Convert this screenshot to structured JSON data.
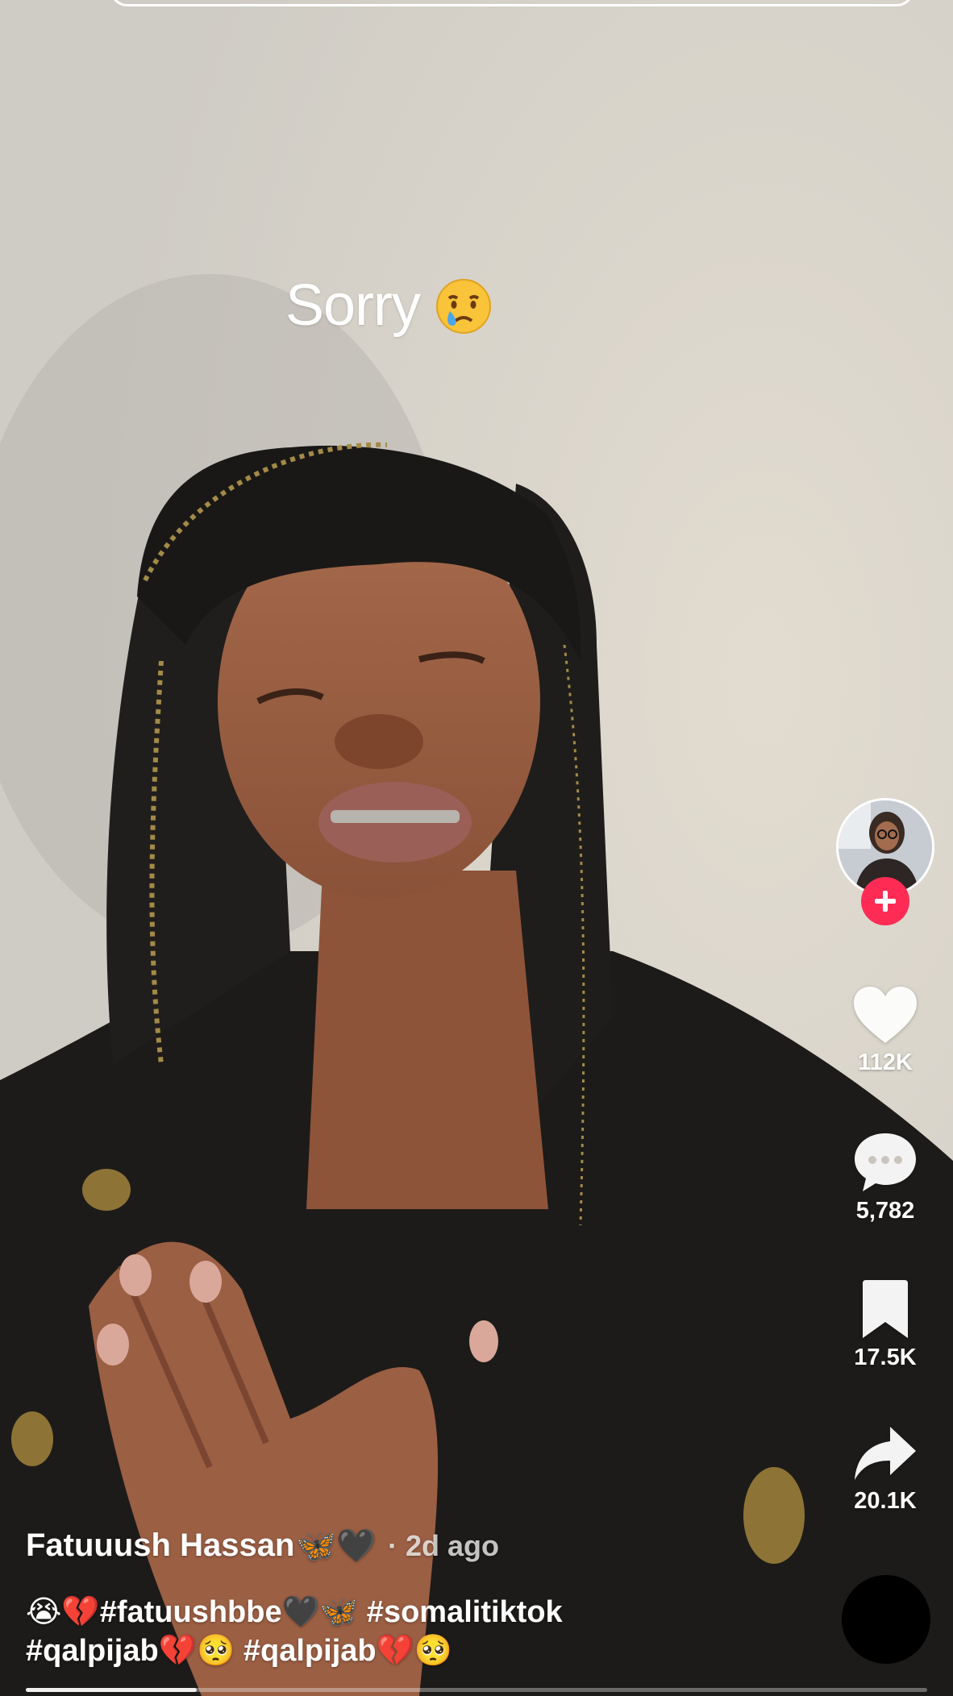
{
  "video": {
    "overlay_caption": "Sorry",
    "overlay_emoji": "crying-face"
  },
  "actions": {
    "likes": "112K",
    "comments": "5,782",
    "saves": "17.5K",
    "shares": "20.1K"
  },
  "author": {
    "name": "Fatuuush Hassan",
    "name_emoji": "🦋🖤",
    "posted": "· 2d ago"
  },
  "description": {
    "line1": "😭💔#fatuushbbe🖤🦋 #somalitiktok",
    "line2": "#qalpijab💔🥺 #qalpijab💔🥺"
  },
  "playback": {
    "progress": 0.19
  },
  "colors": {
    "follow_accent": "#fe2c55",
    "text": "#ffffff"
  },
  "icons": [
    "plus-icon",
    "heart-icon",
    "comment-icon",
    "bookmark-icon",
    "share-icon",
    "music-disc-icon"
  ]
}
